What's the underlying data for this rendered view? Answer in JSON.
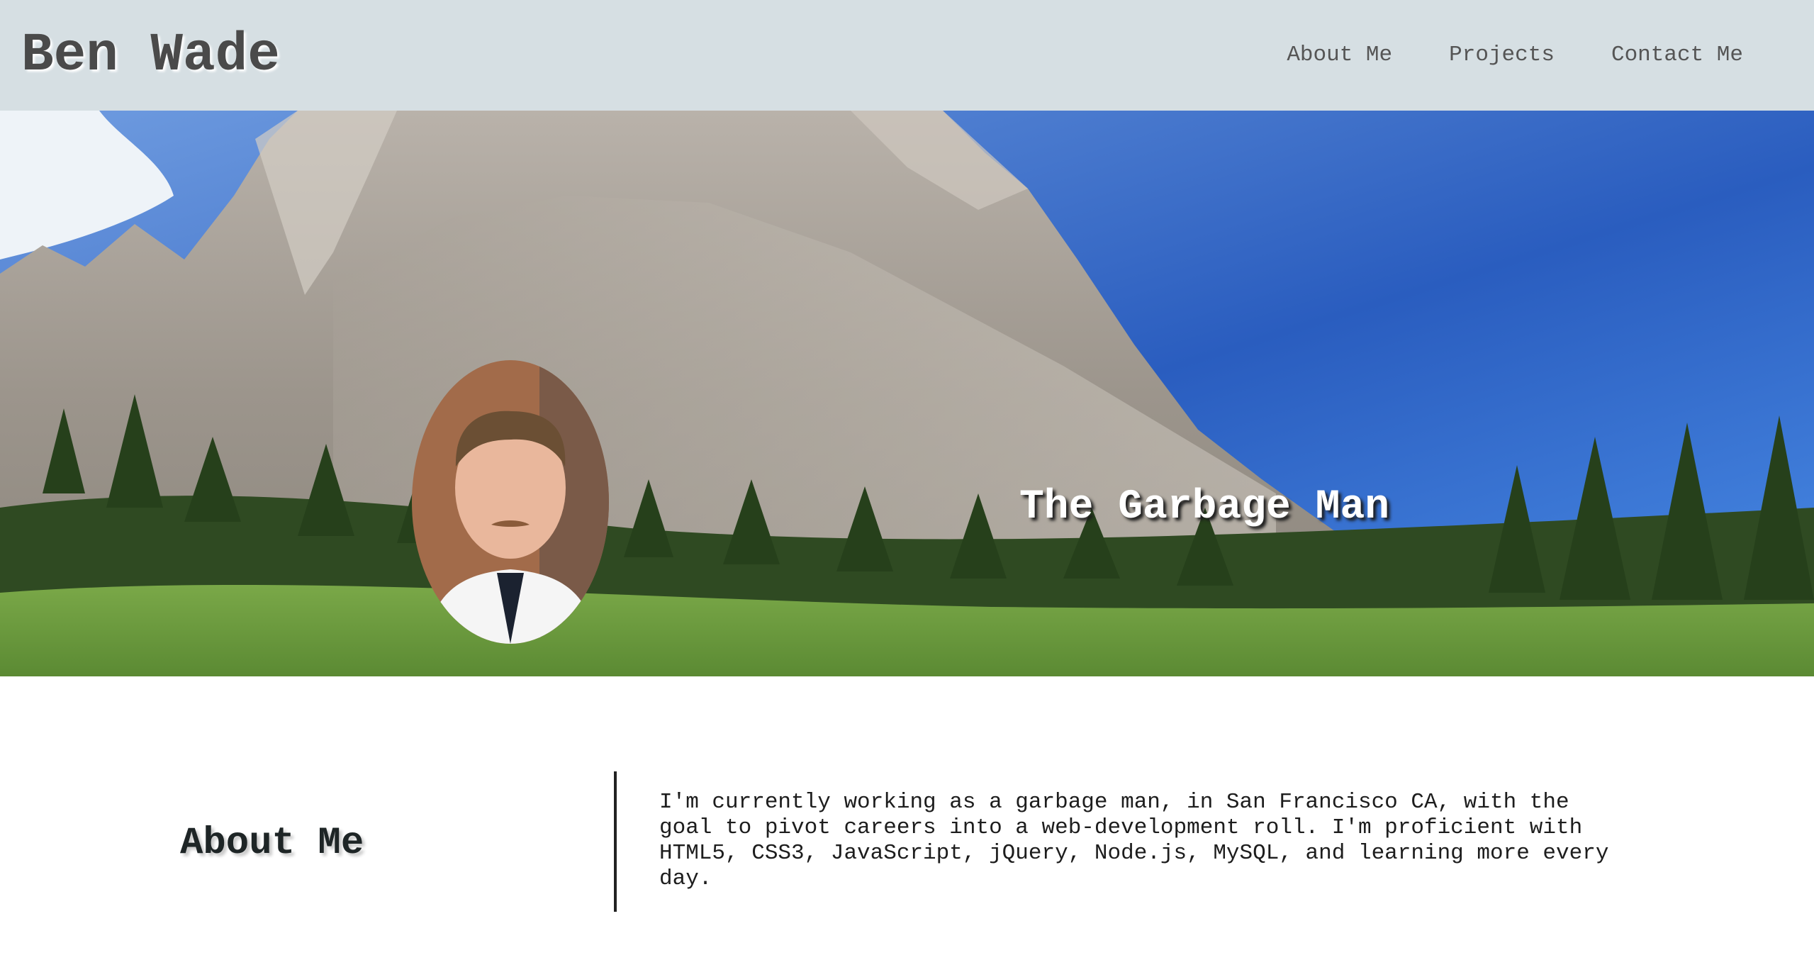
{
  "header": {
    "brand": "Ben Wade",
    "nav": [
      "About Me",
      "Projects",
      "Contact Me"
    ]
  },
  "hero": {
    "tagline": "The Garbage Man",
    "photo_description": "mountain and forest background",
    "avatar_description": "profile photo"
  },
  "about": {
    "title": "About Me",
    "text": "I'm currently working as a garbage man, in San Francisco CA, with the goal to pivot careers into a web-development roll. I'm proficient with HTML5, CSS3, JavaScript, jQuery, Node.js, MySQL, and learning more every day."
  },
  "colors": {
    "header_bg": "#d6dfe3",
    "brand_text": "#4a4a4a",
    "sky_blue": "#2f6fd6"
  }
}
